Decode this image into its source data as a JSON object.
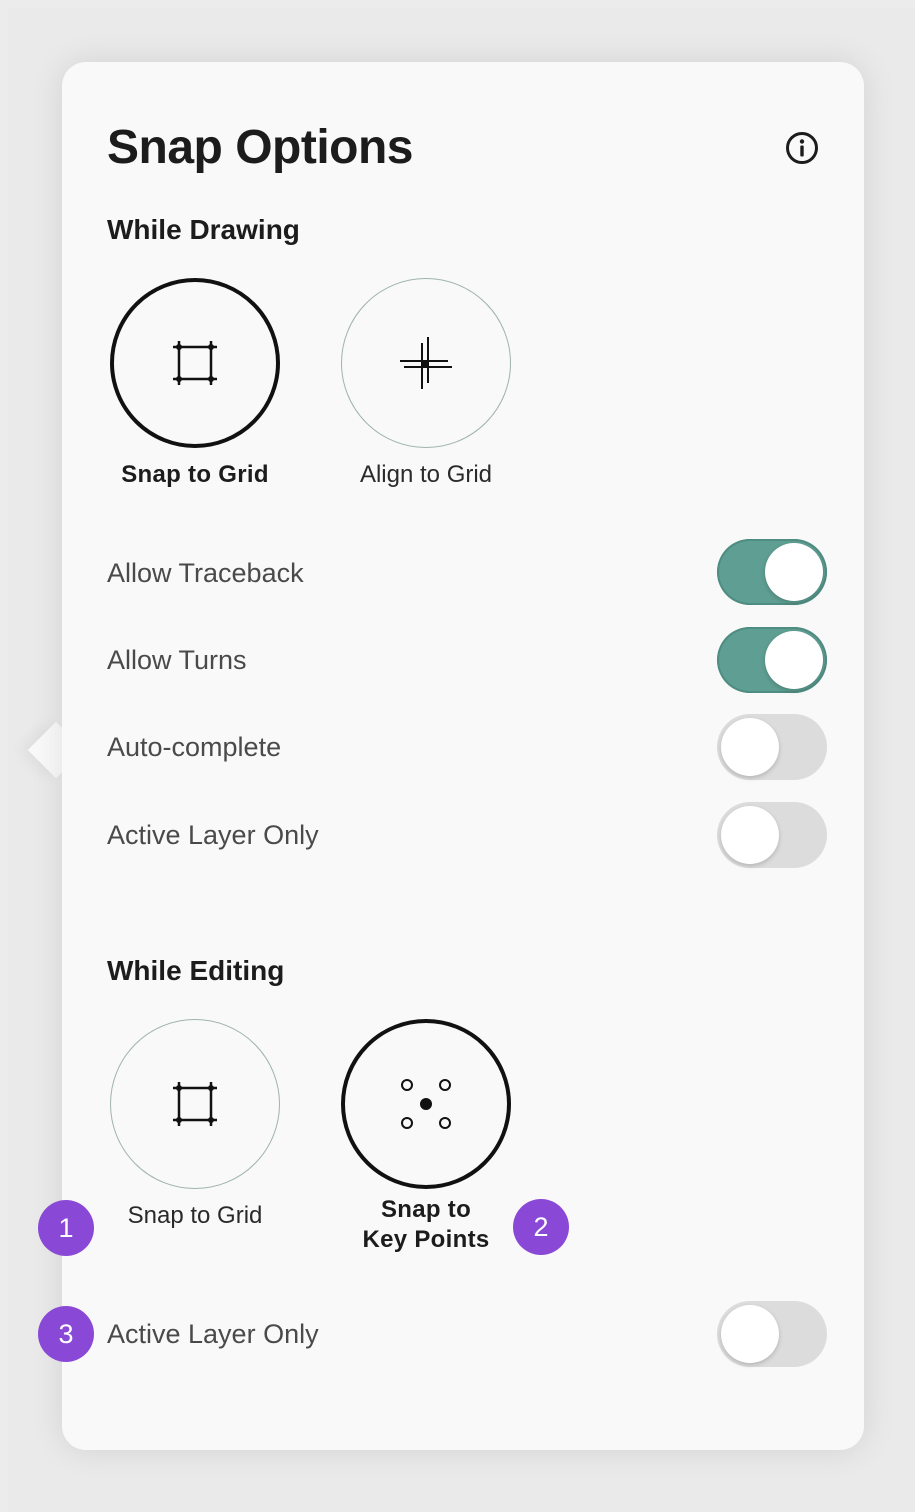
{
  "title": "Snap Options",
  "info_icon": "info-circle-icon",
  "while_drawing": {
    "heading": "While Drawing",
    "options": [
      {
        "label": "Snap to Grid",
        "icon": "snap-grid-icon",
        "selected": true
      },
      {
        "label": "Align to Grid",
        "icon": "align-grid-icon",
        "selected": false
      }
    ],
    "toggles": [
      {
        "label": "Allow Traceback",
        "on": true
      },
      {
        "label": "Allow Turns",
        "on": true
      },
      {
        "label": "Auto-complete",
        "on": false
      },
      {
        "label": "Active Layer Only",
        "on": false
      }
    ]
  },
  "while_editing": {
    "heading": "While Editing",
    "options": [
      {
        "label": "Snap to Grid",
        "icon": "snap-grid-icon",
        "selected": false
      },
      {
        "label": "Snap to\nKey Points",
        "icon": "key-points-icon",
        "selected": true
      }
    ],
    "toggles": [
      {
        "label": "Active Layer Only",
        "on": false
      }
    ]
  },
  "badges": [
    "1",
    "2",
    "3"
  ],
  "colors": {
    "toggle_on": "#5f9e92",
    "toggle_off": "#dcdcdc",
    "badge": "#8a48d6",
    "panel_bg": "#f9f9f9"
  }
}
